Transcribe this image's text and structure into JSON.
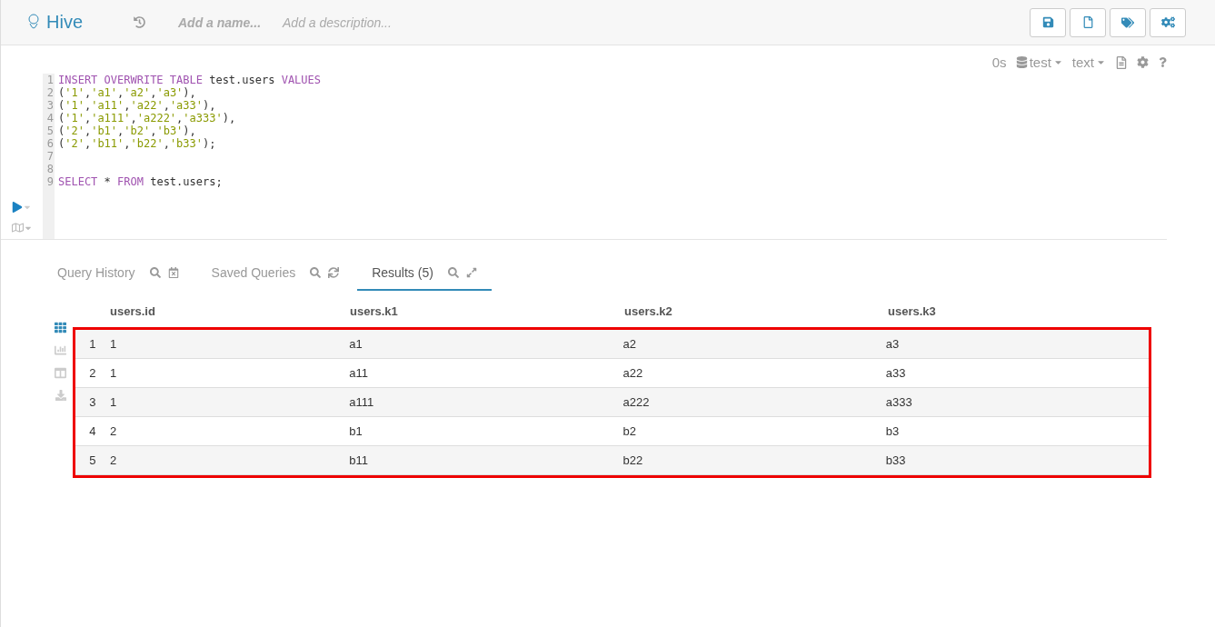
{
  "header": {
    "app_name": "Hive",
    "name_placeholder": "Add a name...",
    "description_placeholder": "Add a description..."
  },
  "editor_toolbar": {
    "duration": "0s",
    "database": "test",
    "format": "text"
  },
  "code_lines": [
    {
      "number": "1",
      "tokens": [
        {
          "kind": "keyword",
          "text": "INSERT OVERWRITE TABLE"
        },
        {
          "kind": "plain",
          "text": " test.users "
        },
        {
          "kind": "keyword",
          "text": "VALUES"
        }
      ]
    },
    {
      "number": "2",
      "tokens": [
        {
          "kind": "plain",
          "text": "("
        },
        {
          "kind": "string",
          "text": "'1'"
        },
        {
          "kind": "plain",
          "text": ","
        },
        {
          "kind": "string",
          "text": "'a1'"
        },
        {
          "kind": "plain",
          "text": ","
        },
        {
          "kind": "string",
          "text": "'a2'"
        },
        {
          "kind": "plain",
          "text": ","
        },
        {
          "kind": "string",
          "text": "'a3'"
        },
        {
          "kind": "plain",
          "text": "),"
        }
      ]
    },
    {
      "number": "3",
      "tokens": [
        {
          "kind": "plain",
          "text": "("
        },
        {
          "kind": "string",
          "text": "'1'"
        },
        {
          "kind": "plain",
          "text": ","
        },
        {
          "kind": "string",
          "text": "'a11'"
        },
        {
          "kind": "plain",
          "text": ","
        },
        {
          "kind": "string",
          "text": "'a22'"
        },
        {
          "kind": "plain",
          "text": ","
        },
        {
          "kind": "string",
          "text": "'a33'"
        },
        {
          "kind": "plain",
          "text": "),"
        }
      ]
    },
    {
      "number": "4",
      "tokens": [
        {
          "kind": "plain",
          "text": "("
        },
        {
          "kind": "string",
          "text": "'1'"
        },
        {
          "kind": "plain",
          "text": ","
        },
        {
          "kind": "string",
          "text": "'a111'"
        },
        {
          "kind": "plain",
          "text": ","
        },
        {
          "kind": "string",
          "text": "'a222'"
        },
        {
          "kind": "plain",
          "text": ","
        },
        {
          "kind": "string",
          "text": "'a333'"
        },
        {
          "kind": "plain",
          "text": "),"
        }
      ]
    },
    {
      "number": "5",
      "tokens": [
        {
          "kind": "plain",
          "text": "("
        },
        {
          "kind": "string",
          "text": "'2'"
        },
        {
          "kind": "plain",
          "text": ","
        },
        {
          "kind": "string",
          "text": "'b1'"
        },
        {
          "kind": "plain",
          "text": ","
        },
        {
          "kind": "string",
          "text": "'b2'"
        },
        {
          "kind": "plain",
          "text": ","
        },
        {
          "kind": "string",
          "text": "'b3'"
        },
        {
          "kind": "plain",
          "text": "),"
        }
      ]
    },
    {
      "number": "6",
      "tokens": [
        {
          "kind": "plain",
          "text": "("
        },
        {
          "kind": "string",
          "text": "'2'"
        },
        {
          "kind": "plain",
          "text": ","
        },
        {
          "kind": "string",
          "text": "'b11'"
        },
        {
          "kind": "plain",
          "text": ","
        },
        {
          "kind": "string",
          "text": "'b22'"
        },
        {
          "kind": "plain",
          "text": ","
        },
        {
          "kind": "string",
          "text": "'b33'"
        },
        {
          "kind": "plain",
          "text": ");"
        }
      ]
    },
    {
      "number": "7"
    },
    {
      "number": "8"
    },
    {
      "number": "9",
      "tokens": [
        {
          "kind": "keyword",
          "text": "SELECT"
        },
        {
          "kind": "plain",
          "text": " * "
        },
        {
          "kind": "keyword",
          "text": "FROM"
        },
        {
          "kind": "plain",
          "text": " test.users;"
        }
      ]
    }
  ],
  "tabs": [
    {
      "label": "Query History",
      "selected": false,
      "kind": "history"
    },
    {
      "label": "Saved Queries",
      "selected": false,
      "kind": "saved"
    },
    {
      "label": "Results (5)",
      "selected": true,
      "kind": "results"
    }
  ],
  "table": {
    "columns": [
      "users.id",
      "users.k1",
      "users.k2",
      "users.k3"
    ],
    "rows": [
      {
        "index": "1",
        "cells": [
          "1",
          "a1",
          "a2",
          "a3"
        ]
      },
      {
        "index": "2",
        "cells": [
          "1",
          "a11",
          "a22",
          "a33"
        ]
      },
      {
        "index": "3",
        "cells": [
          "1",
          "a111",
          "a222",
          "a333"
        ]
      },
      {
        "index": "4",
        "cells": [
          "2",
          "b1",
          "b2",
          "b3"
        ]
      },
      {
        "index": "5",
        "cells": [
          "2",
          "b11",
          "b22",
          "b33"
        ]
      }
    ]
  }
}
